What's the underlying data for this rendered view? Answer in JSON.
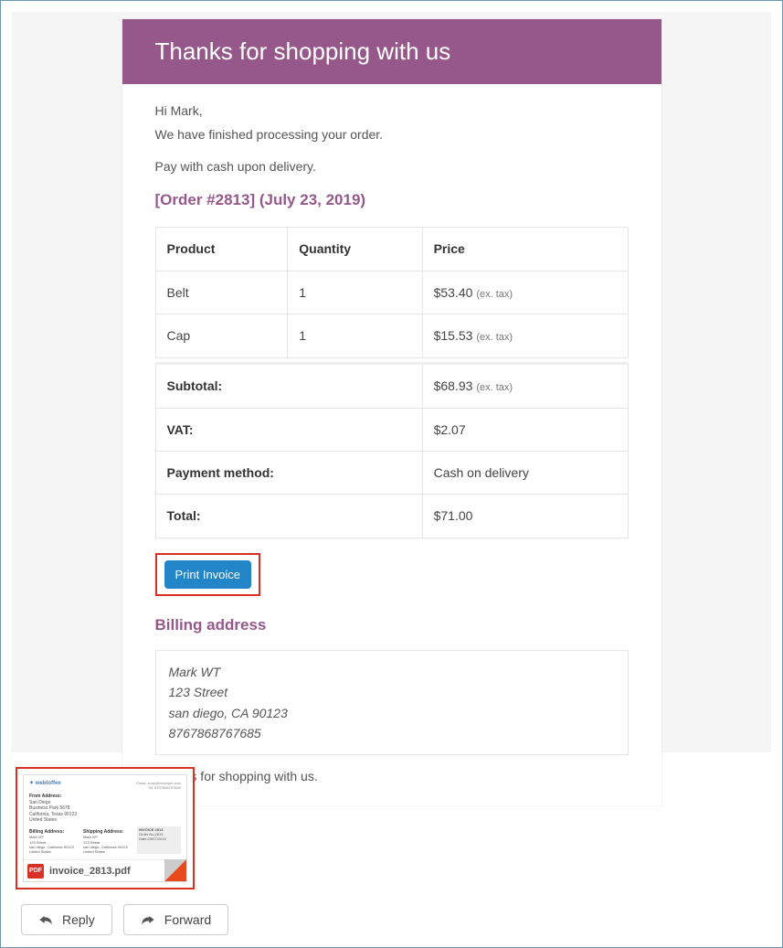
{
  "header": {
    "title": "Thanks for shopping with us"
  },
  "intro": {
    "greeting": "Hi Mark,",
    "processed": "We have finished processing your order.",
    "pay_note": "Pay with cash upon delivery."
  },
  "order": {
    "heading": "[Order #2813] (July 23, 2019)",
    "columns": {
      "product": "Product",
      "quantity": "Quantity",
      "price": "Price"
    },
    "items": [
      {
        "product": "Belt",
        "quantity": "1",
        "price": "$53.40",
        "note": "(ex. tax)"
      },
      {
        "product": "Cap",
        "quantity": "1",
        "price": "$15.53",
        "note": "(ex. tax)"
      }
    ],
    "summary": {
      "subtotal_label": "Subtotal:",
      "subtotal_value": "$68.93",
      "subtotal_note": "(ex. tax)",
      "vat_label": "VAT:",
      "vat_value": "$2.07",
      "payment_label": "Payment method:",
      "payment_value": "Cash on delivery",
      "total_label": "Total:",
      "total_value": "$71.00"
    }
  },
  "buttons": {
    "print_invoice": "Print Invoice",
    "reply": "Reply",
    "forward": "Forward"
  },
  "billing": {
    "heading": "Billing address",
    "name": "Mark WT",
    "street": "123 Street",
    "city": "san diego, CA 90123",
    "phone": "8767868767685"
  },
  "closing": "Thanks for shopping with us.",
  "attachment": {
    "filename": "invoice_2813.pdf",
    "pdf_badge": "PDF",
    "thumb": {
      "logo": "✦ webtoffee",
      "email_line": "Email: shop@example.com",
      "tel_line": "Tel: 8767868767685",
      "from_title": "From Address:",
      "from_l1": "San Diego",
      "from_l2": "Business Park 5678",
      "from_l3": "California, Texas 90123",
      "from_l4": "United States",
      "bill_title": "Billing Address:",
      "ship_title": "Shipping Address:",
      "addr_l1": "Mark WT",
      "addr_l2": "123 Street",
      "addr_l3": "san diego, California 90123",
      "addr_l4": "United States",
      "inv_no": "INVOICE 2813",
      "ord_no": "Order No.2813",
      "ord_date": "Date:23/07/2019"
    }
  }
}
